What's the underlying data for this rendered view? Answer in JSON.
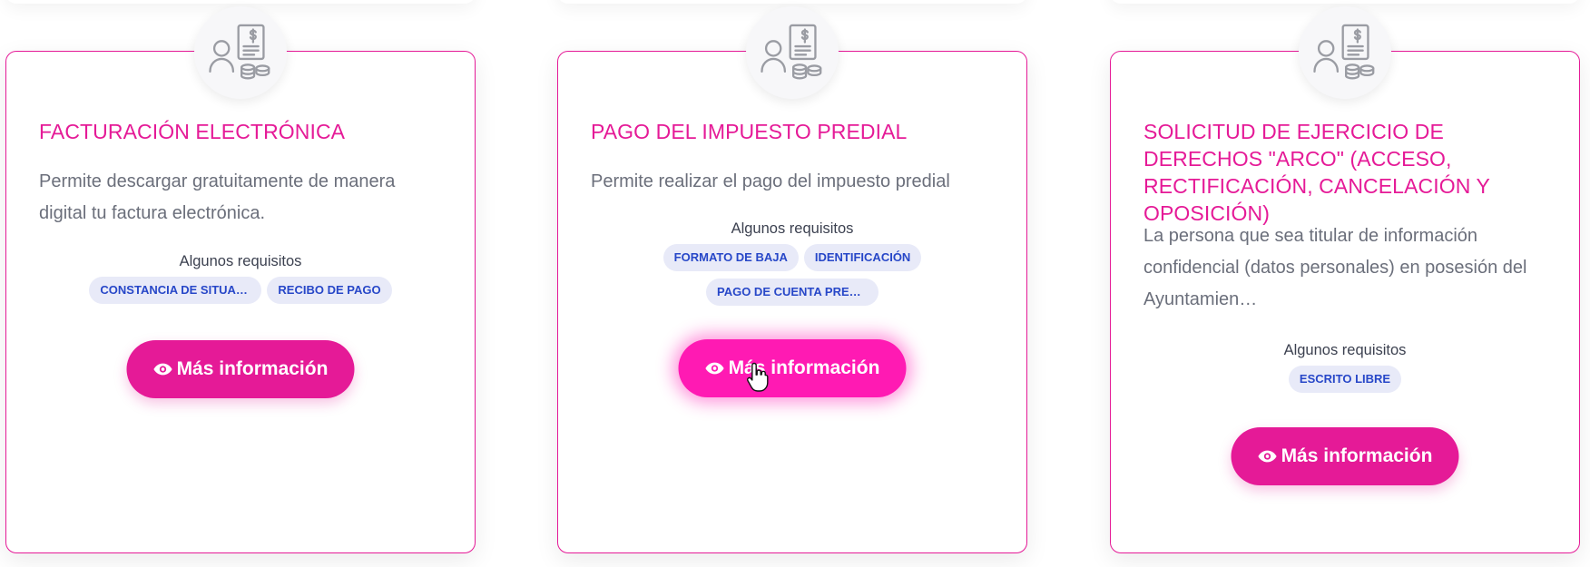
{
  "cards": [
    {
      "icon": "invoice-payment-icon",
      "title": "FACTURACIÓN ELECTRÓNICA",
      "description": "Permite descargar gratuitamente de manera digital tu factura electrónica.",
      "requirements_label": "Algunos requisitos",
      "requirements": [
        "CONSTANCIA DE SITUAC…",
        "RECIBO DE PAGO"
      ],
      "button_label": "Más información"
    },
    {
      "icon": "invoice-payment-icon",
      "title": "PAGO DEL IMPUESTO PREDIAL",
      "description": "Permite realizar el pago del impuesto predial",
      "requirements_label": "Algunos requisitos",
      "requirements": [
        "FORMATO DE BAJA",
        "IDENTIFICACIÓN",
        "PAGO DE CUENTA PREDI…"
      ],
      "button_label": "Más información"
    },
    {
      "icon": "invoice-payment-icon",
      "title": "SOLICITUD DE EJERCICIO DE DERECHOS \"ARCO\" (ACCESO, RECTIFICACIÓN, CANCELACIÓN Y OPOSICIÓN)",
      "description": "La persona que sea titular de información confidencial (datos personales) en posesión del Ayuntamien…",
      "requirements_label": "Algunos requisitos",
      "requirements": [
        "ESCRITO LIBRE"
      ],
      "button_label": "Más información"
    }
  ],
  "colors": {
    "accent": "#e51a97",
    "accent_hover": "#ff1ab3",
    "chip_bg": "#e8eaf8",
    "chip_text": "#2747c8"
  }
}
